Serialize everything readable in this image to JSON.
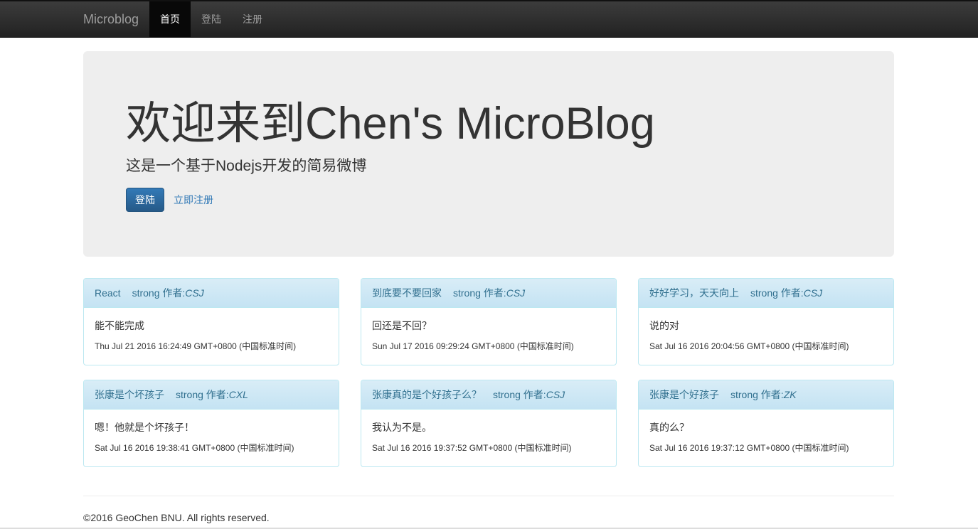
{
  "navbar": {
    "brand": "Microblog",
    "items": [
      {
        "label": "首页",
        "active": true
      },
      {
        "label": "登陆",
        "active": false
      },
      {
        "label": "注册",
        "active": false
      }
    ]
  },
  "jumbotron": {
    "title": "欢迎来到Chen's MicroBlog",
    "subtitle": "这是一个基于Nodejs开发的简易微博",
    "login_button": "登陆",
    "register_link": "立即注册"
  },
  "posts": [
    {
      "title": "React",
      "author_label": "strong 作者:",
      "author": "CSJ",
      "content": "能不能完成",
      "time": "Thu Jul 21 2016 16:24:49 GMT+0800 (中国标准时间)"
    },
    {
      "title": "到底要不要回家",
      "author_label": "strong 作者:",
      "author": "CSJ",
      "content": "回还是不回？",
      "time": "Sun Jul 17 2016 09:29:24 GMT+0800 (中国标准时间)"
    },
    {
      "title": "好好学习，天天向上",
      "author_label": "strong 作者:",
      "author": "CSJ",
      "content": "说的对",
      "time": "Sat Jul 16 2016 20:04:56 GMT+0800 (中国标准时间)"
    },
    {
      "title": "张康是个坏孩子",
      "author_label": "strong 作者:",
      "author": "CXL",
      "content": "嗯！他就是个坏孩子！",
      "time": "Sat Jul 16 2016 19:38:41 GMT+0800 (中国标准时间)"
    },
    {
      "title": "张康真的是个好孩子么？",
      "author_label": "strong 作者:",
      "author": "CSJ",
      "content": "我认为不是。",
      "time": "Sat Jul 16 2016 19:37:52 GMT+0800 (中国标准时间)"
    },
    {
      "title": "张康是个好孩子",
      "author_label": "strong 作者:",
      "author": "ZK",
      "content": "真的么？",
      "time": "Sat Jul 16 2016 19:37:12 GMT+0800 (中国标准时间)"
    }
  ],
  "footer": {
    "text": "©2016 GeoChen BNU. All rights reserved."
  },
  "colors": {
    "navbar_bg": "#222222",
    "jumbotron_bg": "#eeeeee",
    "primary": "#337ab7",
    "panel_heading_bg": "#d9edf7",
    "panel_text": "#31708f"
  }
}
